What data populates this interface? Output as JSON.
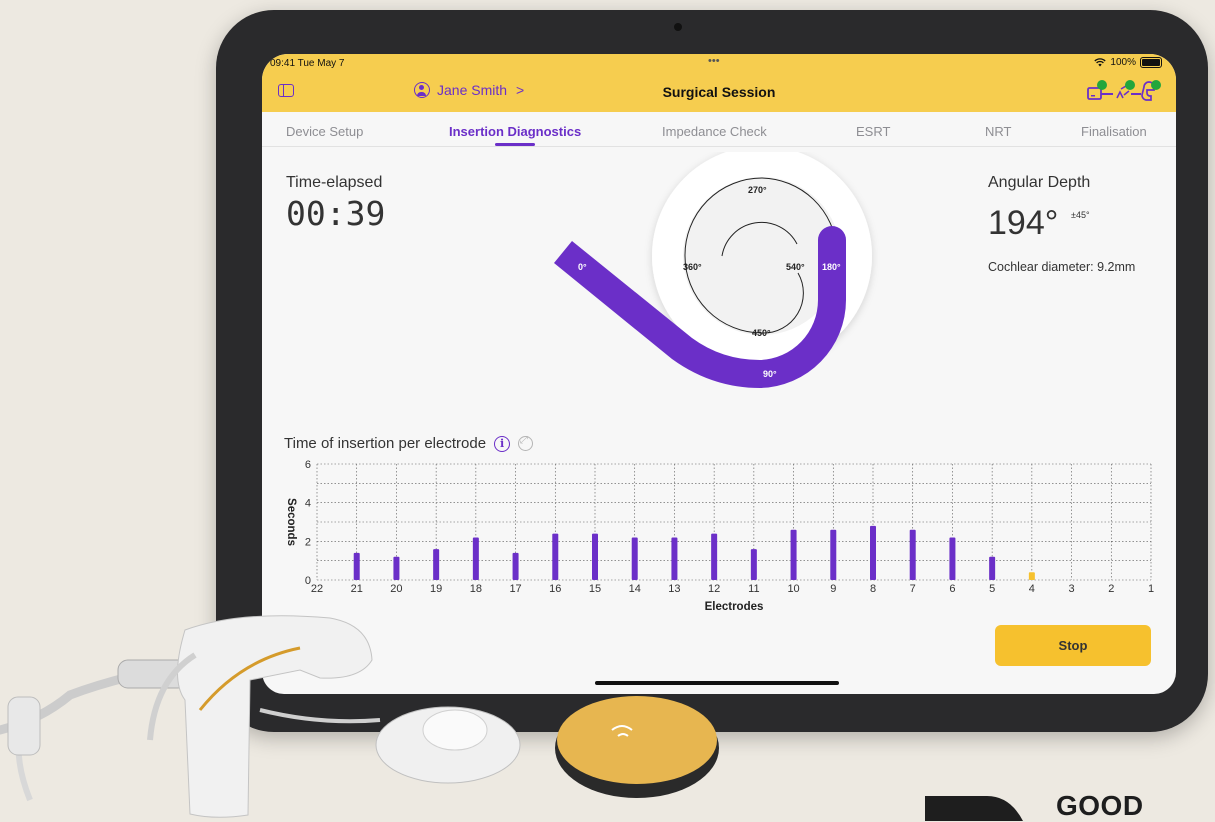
{
  "status_bar": {
    "time": "09:41  Tue May 7",
    "dots": "•••",
    "battery": "100%"
  },
  "nav": {
    "patient_name": "Jane Smith",
    "chevron": ">",
    "title": "Surgical Session"
  },
  "tabs": [
    {
      "label": "Device Setup"
    },
    {
      "label": "Insertion Diagnostics"
    },
    {
      "label": "Impedance Check"
    },
    {
      "label": "ESRT"
    },
    {
      "label": "NRT"
    },
    {
      "label": "Finalisation"
    }
  ],
  "timer": {
    "label": "Time-elapsed",
    "value": "00:39"
  },
  "angular": {
    "label": "Angular Depth",
    "value": "194°",
    "tolerance": "±45°",
    "cochlear_diameter": "Cochlear diameter: 9.2mm"
  },
  "spiral": {
    "labels": [
      "0°",
      "90°",
      "180°",
      "270°",
      "360°",
      "450°",
      "540°"
    ]
  },
  "chart_title": "Time of insertion per electrode",
  "info_glyph": "i",
  "stop_label": "Stop",
  "brand_text": "GOOD",
  "colors": {
    "accent": "#6b2fc8",
    "header": "#f6cd4f",
    "stop": "#f6c12e",
    "current_bar": "#f6c12e"
  },
  "chart_data": {
    "type": "bar",
    "title": "Time of insertion per electrode",
    "xlabel": "Electrodes",
    "ylabel": "Seconds",
    "ylim": [
      0,
      6
    ],
    "yticks": [
      0,
      2,
      4,
      6
    ],
    "grid": true,
    "categories": [
      "22",
      "21",
      "20",
      "19",
      "18",
      "17",
      "16",
      "15",
      "14",
      "13",
      "12",
      "11",
      "10",
      "9",
      "8",
      "7",
      "6",
      "5",
      "4",
      "3",
      "2",
      "1"
    ],
    "values": [
      null,
      1.4,
      1.2,
      1.6,
      2.2,
      1.4,
      2.4,
      2.4,
      2.2,
      2.2,
      2.4,
      1.6,
      2.6,
      2.6,
      2.8,
      2.6,
      2.2,
      1.2,
      0.4,
      null,
      null,
      null
    ],
    "highlight_category": "4"
  }
}
